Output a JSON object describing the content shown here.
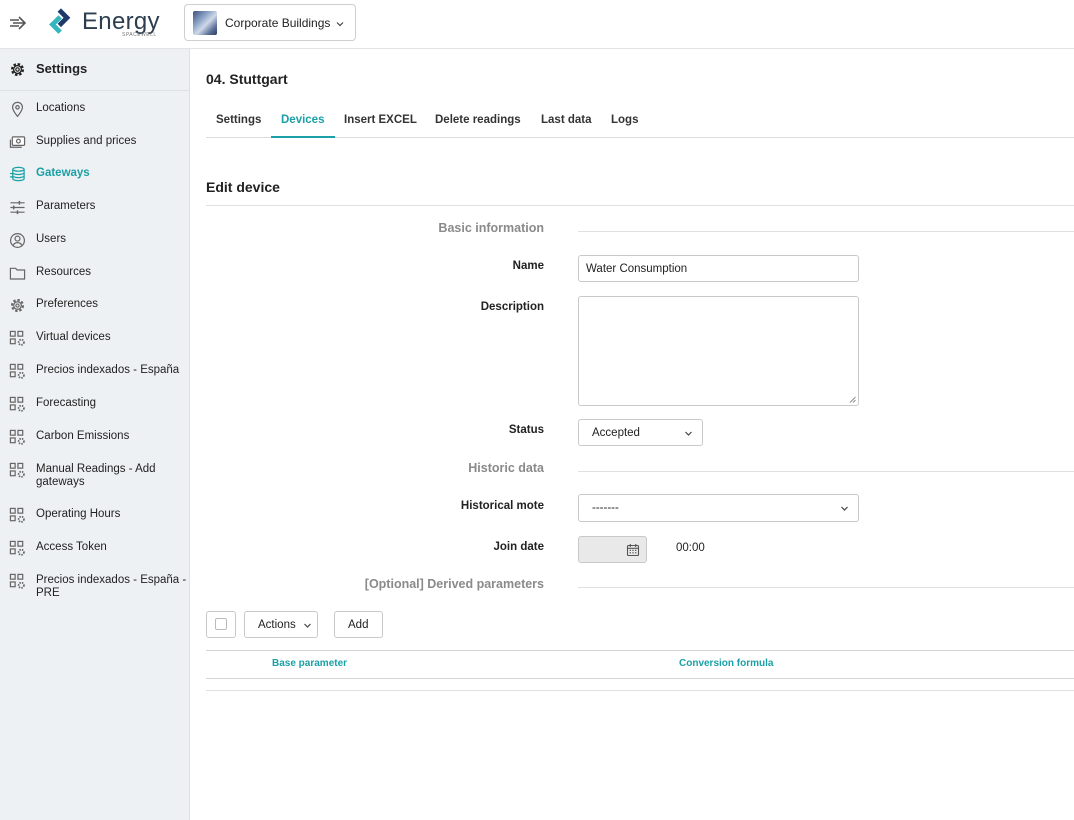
{
  "app": {
    "logo_text": "Energy",
    "logo_sub": "SPACEWELL",
    "building_selector": "Corporate Buildings"
  },
  "colors": {
    "accent": "#1aa0a6",
    "sidebar_bg": "#eef1f3",
    "muted_label": "#8a8a8a"
  },
  "sidebar": {
    "header": {
      "label": "Settings",
      "icon": "gear-icon"
    },
    "items": [
      {
        "label": "Locations",
        "icon": "location-pin-icon",
        "active": false
      },
      {
        "label": "Supplies and prices",
        "icon": "money-icon",
        "active": false
      },
      {
        "label": "Gateways",
        "icon": "database-icon",
        "active": true
      },
      {
        "label": "Parameters",
        "icon": "sliders-icon",
        "active": false
      },
      {
        "label": "Users",
        "icon": "user-circle-icon",
        "active": false
      },
      {
        "label": "Resources",
        "icon": "folder-icon",
        "active": false
      },
      {
        "label": "Preferences",
        "icon": "cog-icon",
        "active": false
      },
      {
        "label": "Virtual devices",
        "icon": "grid-gear-icon",
        "active": false
      },
      {
        "label": "Precios indexados - España",
        "icon": "grid-gear-icon",
        "active": false
      },
      {
        "label": "Forecasting",
        "icon": "grid-gear-icon",
        "active": false
      },
      {
        "label": "Carbon Emissions",
        "icon": "grid-gear-icon",
        "active": false
      },
      {
        "label": "Manual Readings - Add gateways",
        "icon": "grid-gear-icon",
        "active": false
      },
      {
        "label": "Operating Hours",
        "icon": "grid-gear-icon",
        "active": false
      },
      {
        "label": "Access Token",
        "icon": "grid-gear-icon",
        "active": false
      },
      {
        "label": "Precios indexados - España - PRE",
        "icon": "grid-gear-icon",
        "active": false
      }
    ]
  },
  "main": {
    "page_title": "04. Stuttgart",
    "tabs": [
      {
        "label": "Settings",
        "active": false
      },
      {
        "label": "Devices",
        "active": true
      },
      {
        "label": "Insert EXCEL",
        "active": false
      },
      {
        "label": "Delete readings",
        "active": false
      },
      {
        "label": "Last data",
        "active": false
      },
      {
        "label": "Logs",
        "active": false
      }
    ],
    "section_title": "Edit device",
    "basic_information": "Basic information",
    "name_label": "Name",
    "name_value": "Water Consumption",
    "description_label": "Description",
    "description_value": "",
    "status_label": "Status",
    "status_value": "Accepted",
    "historic_data": "Historic data",
    "historical_mote_label": "Historical mote",
    "historical_mote_value": "-------",
    "join_date_label": "Join date",
    "join_date_value": "",
    "join_time": "00:00",
    "derived_parameters": "[Optional] Derived parameters",
    "actions_label": "Actions",
    "add_label": "Add",
    "table_headers": [
      "Base parameter",
      "Conversion formula"
    ]
  }
}
